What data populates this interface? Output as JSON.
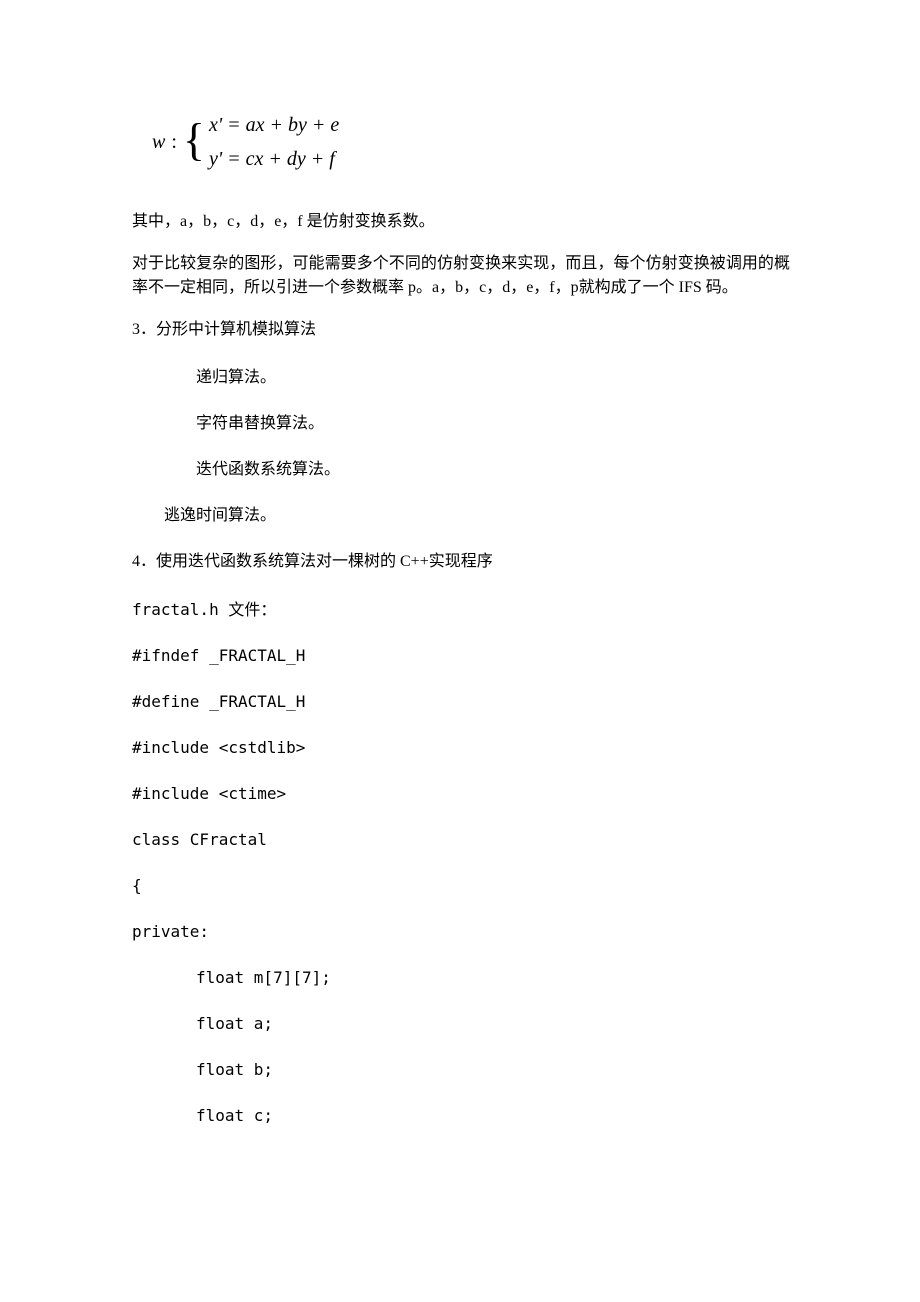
{
  "formula": {
    "lhs": "w",
    "line1": "x' = ax + by + e",
    "line2": "y' = cx + dy + f"
  },
  "para1": "其中，a，b，c，d，e，f 是仿射变换系数。",
  "para2": "对于比较复杂的图形，可能需要多个不同的仿射变换来实现，而且，每个仿射变换被调用的概率不一定相同，所以引进一个参数概率 p。a，b，c，d，e，f，p就构成了一个 IFS 码。",
  "sec3_title": "3．分形中计算机模拟算法",
  "sec3_items": [
    "递归算法。",
    "字符串替换算法。",
    "迭代函数系统算法。"
  ],
  "sec3_last": "逃逸时间算法。",
  "sec4_title": "4．使用迭代函数系统算法对一棵树的 C++实现程序",
  "file_label": "fractal.h 文件：",
  "code_lines": [
    "#ifndef _FRACTAL_H",
    "#define _FRACTAL_H",
    "#include <cstdlib>",
    "#include <ctime>",
    "class CFractal",
    "{",
    "private:"
  ],
  "members": [
    "float m[7][7];",
    "float a;",
    "float b;",
    "float c;"
  ]
}
